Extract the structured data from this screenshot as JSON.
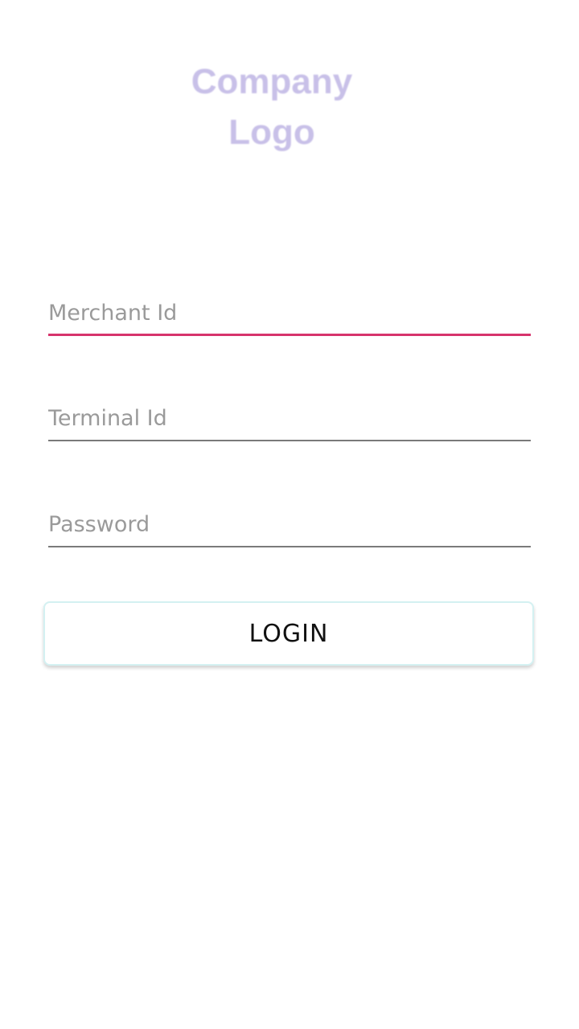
{
  "logo": {
    "line1": "Company",
    "line2": "Logo"
  },
  "form": {
    "merchant_id": {
      "value": "",
      "placeholder": "Merchant Id"
    },
    "terminal_id": {
      "value": "",
      "placeholder": "Terminal Id"
    },
    "password": {
      "value": "",
      "placeholder": "Password"
    },
    "login_label": "LOGIN"
  },
  "colors": {
    "focus_underline": "#d6336c",
    "underline": "#7a7a7a",
    "logo_text": "#c8c0e8",
    "button_border": "#d4f1f2"
  }
}
